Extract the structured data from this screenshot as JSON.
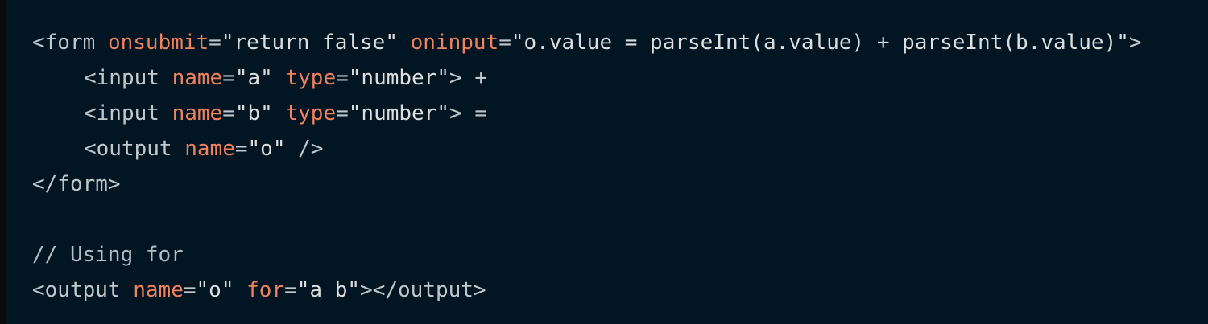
{
  "colors": {
    "background": "#021522",
    "tag": "#c3c7cc",
    "attribute": "#f0825e",
    "string": "#dedede",
    "comment": "#b5bcc4"
  },
  "code": {
    "line1": {
      "open": "<form",
      "attr1": "onsubmit",
      "eq1": "=",
      "val1": "\"return false\"",
      "attr2": "oninput",
      "eq2": "=",
      "val2": "\"o.value = parseInt(a.value) + parseInt(b.value)\"",
      "close": ">"
    },
    "line2": {
      "open": "<input",
      "attr1": "name",
      "eq1": "=",
      "val1": "\"a\"",
      "attr2": "type",
      "eq2": "=",
      "val2": "\"number\"",
      "close": ">",
      "operator": "+"
    },
    "line3": {
      "open": "<input",
      "attr1": "name",
      "eq1": "=",
      "val1": "\"b\"",
      "attr2": "type",
      "eq2": "=",
      "val2": "\"number\"",
      "close": ">",
      "operator": "="
    },
    "line4": {
      "open": "<output",
      "attr1": "name",
      "eq1": "=",
      "val1": "\"o\"",
      "close": "/>"
    },
    "line5": {
      "tag": "</form>"
    },
    "line7": {
      "comment": "// Using for"
    },
    "line8": {
      "open": "<output",
      "attr1": "name",
      "eq1": "=",
      "val1": "\"o\"",
      "attr2": "for",
      "eq2": "=",
      "val2": "\"a b\"",
      "close": "></output>"
    }
  }
}
